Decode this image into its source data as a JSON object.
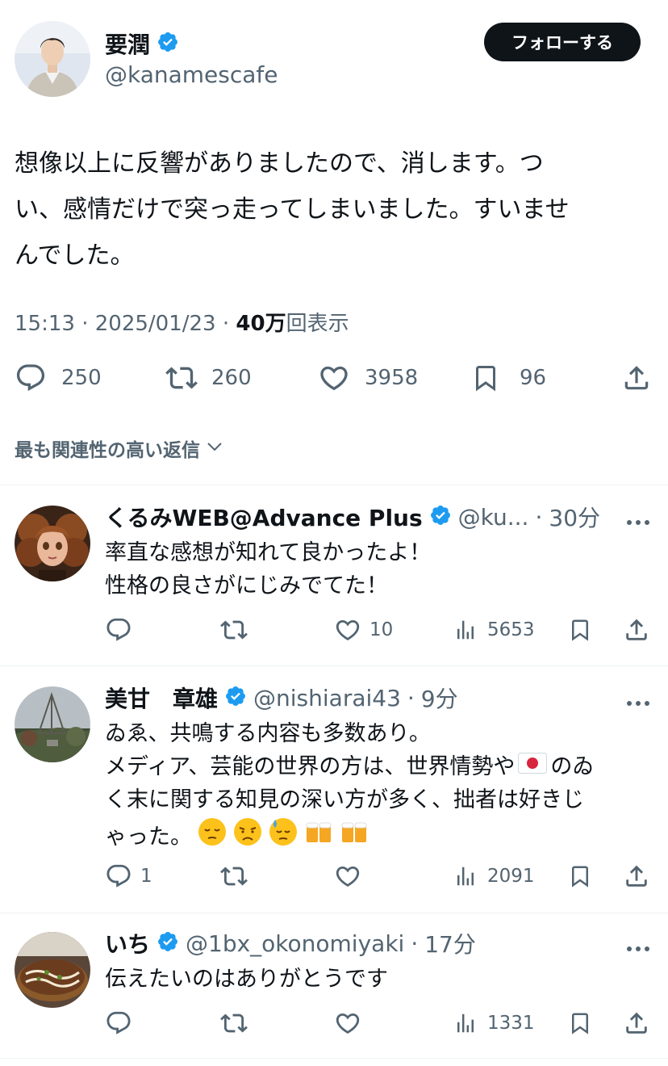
{
  "author": {
    "name": "要潤",
    "handle": "@kanamescafe",
    "follow_label": "フォローする"
  },
  "tweet": {
    "text_line1": "想像以上に反響がありましたので、消します。つ",
    "text_line2": "い、感情だけで突っ走ってしまいました。すいませ",
    "text_line3": "んでした。",
    "time": "15:13",
    "sep1": "·",
    "date": "2025/01/23",
    "sep2": "·",
    "views": "40万",
    "views_suffix": "回表示",
    "replies": "250",
    "retweets": "260",
    "likes": "3958",
    "bookmarks": "96"
  },
  "sort": {
    "label": "最も関連性の高い返信"
  },
  "replies": [
    {
      "name": "くるみWEB@Advance Plus",
      "handle": "@ku...",
      "time": "30分",
      "line1": "率直な感想が知れて良かったよ！",
      "line2": "性格の良さがにじみでてた！",
      "reply_count": "",
      "retweet_count": "",
      "like_count": "10",
      "view_count": "5653"
    },
    {
      "name": "美甘　章雄",
      "handle": "@nishiarai43",
      "time": "9分",
      "line1": "ゐゑ、共鳴する内容も多数あり。",
      "line2": "メディア、芸能の世界の方は、世界情勢や",
      "line2_tail": "のゐ",
      "line3": "く末に関する知見の深い方が多く、拙者は好きじ",
      "line4": "ゃった。",
      "reply_count": "1",
      "retweet_count": "",
      "like_count": "",
      "view_count": "2091"
    },
    {
      "name": "いち",
      "handle": "@1bx_okonomiyaki",
      "time": "17分",
      "line1": "伝えたいのはありがとうです",
      "reply_count": "",
      "retweet_count": "",
      "like_count": "",
      "view_count": "1331"
    }
  ],
  "icons": {
    "verified": "verified-badge-icon",
    "reply": "reply-icon",
    "retweet": "retweet-icon",
    "like": "heart-icon",
    "views": "views-icon",
    "bookmark": "bookmark-icon",
    "share": "share-icon",
    "more": "more-icon",
    "chevron": "chevron-down-icon"
  },
  "colors": {
    "verified": "#1d9bf0",
    "text": "#0f1419",
    "muted": "#536471",
    "divider": "#eff3f4",
    "button": "#0f1419"
  }
}
